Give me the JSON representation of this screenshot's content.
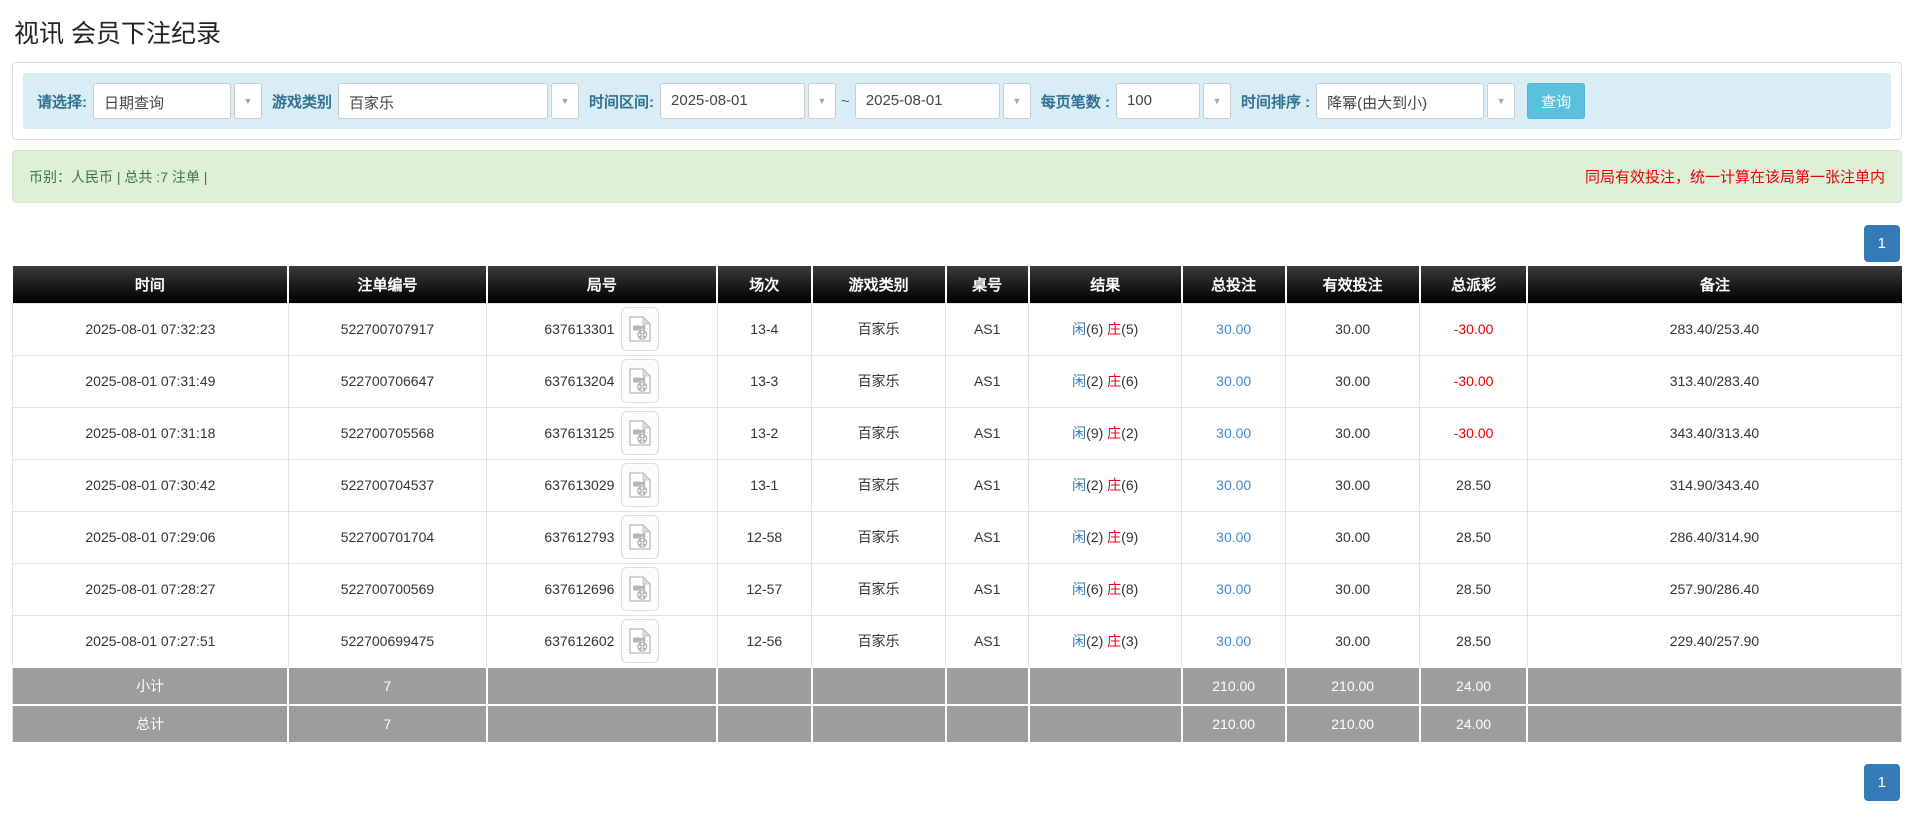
{
  "page_title": "视讯 会员下注纪录",
  "filters": {
    "select_label": "请选择:",
    "select_value": "日期查询",
    "game_type_label": "游戏类别",
    "game_type_value": "百家乐",
    "time_range_label": "时间区间:",
    "date_from": "2025-08-01",
    "range_separator": "~",
    "date_to": "2025-08-01",
    "page_size_label": "每页笔数 :",
    "page_size_value": "100",
    "sort_label": "时间排序 :",
    "sort_value": "降幂(由大到小)",
    "search_button_label": "查询"
  },
  "summary_bar": {
    "left_text": "币别：人民币 | 总共 :7 注单 |",
    "right_note": "同局有效投注，统一计算在该局第一张注单内"
  },
  "pagination": {
    "current_page": "1"
  },
  "icons": {
    "combo_caret": "▼",
    "video_icon": "video-file-icon"
  },
  "colors": {
    "accent_blue": "#337ab7",
    "search_button_blue": "#5bc0de",
    "filter_bar_bg": "#d9edf7",
    "alert_green_bg": "#dff0d8",
    "alert_green_text": "#3c763d",
    "alert_red_text": "#e60000",
    "link_blue": "#428bca",
    "player_blue": "#337ab7",
    "banker_red": "#e60012",
    "negative_red": "#e60000",
    "table_header_bg": "#161616",
    "summary_row_bg": "#9d9d9d"
  },
  "table": {
    "headers": [
      "时间",
      "注单编号",
      "局号",
      "场次",
      "游戏类别",
      "桌号",
      "结果",
      "总投注",
      "有效投注",
      "总派彩",
      "备注"
    ],
    "col_widths_percent": [
      14.6,
      10.5,
      12.2,
      5.0,
      7.1,
      4.4,
      8.1,
      5.5,
      7.1,
      5.7,
      19.8
    ],
    "rows": [
      {
        "time": "2025-08-01 07:32:23",
        "bet_id": "522700707917",
        "round_id": "637613301",
        "session": "13-4",
        "game_type": "百家乐",
        "table_no": "AS1",
        "result_player_label": "闲",
        "result_player_value": "(6)",
        "result_banker_label": "庄",
        "result_banker_value": "(5)",
        "total_bet": "30.00",
        "valid_bet": "30.00",
        "payout": "-30.00",
        "note": "283.40/253.40"
      },
      {
        "time": "2025-08-01 07:31:49",
        "bet_id": "522700706647",
        "round_id": "637613204",
        "session": "13-3",
        "game_type": "百家乐",
        "table_no": "AS1",
        "result_player_label": "闲",
        "result_player_value": "(2)",
        "result_banker_label": "庄",
        "result_banker_value": "(6)",
        "total_bet": "30.00",
        "valid_bet": "30.00",
        "payout": "-30.00",
        "note": "313.40/283.40"
      },
      {
        "time": "2025-08-01 07:31:18",
        "bet_id": "522700705568",
        "round_id": "637613125",
        "session": "13-2",
        "game_type": "百家乐",
        "table_no": "AS1",
        "result_player_label": "闲",
        "result_player_value": "(9)",
        "result_banker_label": "庄",
        "result_banker_value": "(2)",
        "total_bet": "30.00",
        "valid_bet": "30.00",
        "payout": "-30.00",
        "note": "343.40/313.40"
      },
      {
        "time": "2025-08-01 07:30:42",
        "bet_id": "522700704537",
        "round_id": "637613029",
        "session": "13-1",
        "game_type": "百家乐",
        "table_no": "AS1",
        "result_player_label": "闲",
        "result_player_value": "(2)",
        "result_banker_label": "庄",
        "result_banker_value": "(6)",
        "total_bet": "30.00",
        "valid_bet": "30.00",
        "payout": "28.50",
        "note": "314.90/343.40"
      },
      {
        "time": "2025-08-01 07:29:06",
        "bet_id": "522700701704",
        "round_id": "637612793",
        "session": "12-58",
        "game_type": "百家乐",
        "table_no": "AS1",
        "result_player_label": "闲",
        "result_player_value": "(2)",
        "result_banker_label": "庄",
        "result_banker_value": "(9)",
        "total_bet": "30.00",
        "valid_bet": "30.00",
        "payout": "28.50",
        "note": "286.40/314.90"
      },
      {
        "time": "2025-08-01 07:28:27",
        "bet_id": "522700700569",
        "round_id": "637612696",
        "session": "12-57",
        "game_type": "百家乐",
        "table_no": "AS1",
        "result_player_label": "闲",
        "result_player_value": "(6)",
        "result_banker_label": "庄",
        "result_banker_value": "(8)",
        "total_bet": "30.00",
        "valid_bet": "30.00",
        "payout": "28.50",
        "note": "257.90/286.40"
      },
      {
        "time": "2025-08-01 07:27:51",
        "bet_id": "522700699475",
        "round_id": "637612602",
        "session": "12-56",
        "game_type": "百家乐",
        "table_no": "AS1",
        "result_player_label": "闲",
        "result_player_value": "(2)",
        "result_banker_label": "庄",
        "result_banker_value": "(3)",
        "total_bet": "30.00",
        "valid_bet": "30.00",
        "payout": "28.50",
        "note": "229.40/257.90"
      }
    ],
    "summary_rows": [
      {
        "label": "小计",
        "count": "7",
        "total_bet": "210.00",
        "valid_bet": "210.00",
        "payout": "24.00"
      },
      {
        "label": "总计",
        "count": "7",
        "total_bet": "210.00",
        "valid_bet": "210.00",
        "payout": "24.00"
      }
    ]
  }
}
